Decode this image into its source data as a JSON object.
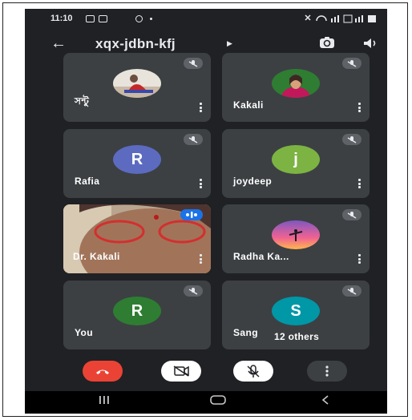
{
  "status_bar": {
    "time": "11:10"
  },
  "app_bar": {
    "meeting_code": "xqx-jdbn-kfj"
  },
  "participants": [
    {
      "name": "সন্টু",
      "avatar": "photo",
      "muted": true
    },
    {
      "name": "Kakali",
      "avatar": "photo",
      "muted": true
    },
    {
      "name": "Rafia",
      "avatar_letter": "R",
      "avatar_color": "#5c6bc0",
      "muted": true
    },
    {
      "name": "joydeep",
      "avatar_letter": "j",
      "avatar_color": "#7cb342",
      "muted": true
    },
    {
      "name": "Dr. Kakali",
      "avatar": "video",
      "muted": false,
      "speaking": true
    },
    {
      "name": "Radha Ka...",
      "avatar": "photo",
      "muted": true
    },
    {
      "name": "You",
      "avatar_letter": "R",
      "avatar_color": "#2e7d32",
      "muted": true
    },
    {
      "name": "Sang",
      "avatar_letter": "S",
      "avatar_color": "#0097a7",
      "muted": true
    }
  ],
  "others_label": "12 others",
  "controls": {
    "end_call": "end-call",
    "camera": "camera-off",
    "microphone": "mic-off",
    "more": "more-options"
  },
  "colors": {
    "background": "#202124",
    "tile": "#3c4043",
    "end_call_red": "#ea4335"
  }
}
